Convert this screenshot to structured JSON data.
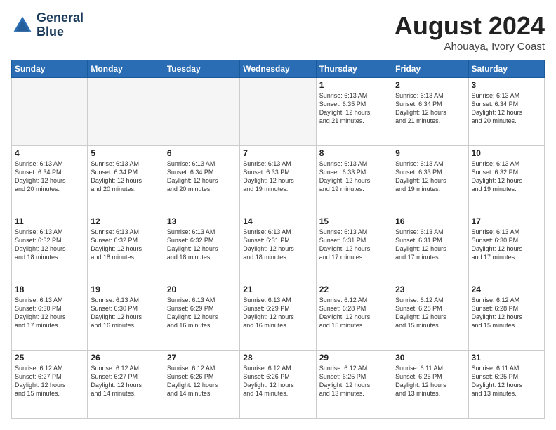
{
  "header": {
    "logo_line1": "General",
    "logo_line2": "Blue",
    "month_year": "August 2024",
    "location": "Ahouaya, Ivory Coast"
  },
  "days_of_week": [
    "Sunday",
    "Monday",
    "Tuesday",
    "Wednesday",
    "Thursday",
    "Friday",
    "Saturday"
  ],
  "weeks": [
    [
      {
        "date": "",
        "text": ""
      },
      {
        "date": "",
        "text": ""
      },
      {
        "date": "",
        "text": ""
      },
      {
        "date": "",
        "text": ""
      },
      {
        "date": "1",
        "text": "Sunrise: 6:13 AM\nSunset: 6:35 PM\nDaylight: 12 hours\nand 21 minutes."
      },
      {
        "date": "2",
        "text": "Sunrise: 6:13 AM\nSunset: 6:34 PM\nDaylight: 12 hours\nand 21 minutes."
      },
      {
        "date": "3",
        "text": "Sunrise: 6:13 AM\nSunset: 6:34 PM\nDaylight: 12 hours\nand 20 minutes."
      }
    ],
    [
      {
        "date": "4",
        "text": "Sunrise: 6:13 AM\nSunset: 6:34 PM\nDaylight: 12 hours\nand 20 minutes."
      },
      {
        "date": "5",
        "text": "Sunrise: 6:13 AM\nSunset: 6:34 PM\nDaylight: 12 hours\nand 20 minutes."
      },
      {
        "date": "6",
        "text": "Sunrise: 6:13 AM\nSunset: 6:34 PM\nDaylight: 12 hours\nand 20 minutes."
      },
      {
        "date": "7",
        "text": "Sunrise: 6:13 AM\nSunset: 6:33 PM\nDaylight: 12 hours\nand 19 minutes."
      },
      {
        "date": "8",
        "text": "Sunrise: 6:13 AM\nSunset: 6:33 PM\nDaylight: 12 hours\nand 19 minutes."
      },
      {
        "date": "9",
        "text": "Sunrise: 6:13 AM\nSunset: 6:33 PM\nDaylight: 12 hours\nand 19 minutes."
      },
      {
        "date": "10",
        "text": "Sunrise: 6:13 AM\nSunset: 6:32 PM\nDaylight: 12 hours\nand 19 minutes."
      }
    ],
    [
      {
        "date": "11",
        "text": "Sunrise: 6:13 AM\nSunset: 6:32 PM\nDaylight: 12 hours\nand 18 minutes."
      },
      {
        "date": "12",
        "text": "Sunrise: 6:13 AM\nSunset: 6:32 PM\nDaylight: 12 hours\nand 18 minutes."
      },
      {
        "date": "13",
        "text": "Sunrise: 6:13 AM\nSunset: 6:32 PM\nDaylight: 12 hours\nand 18 minutes."
      },
      {
        "date": "14",
        "text": "Sunrise: 6:13 AM\nSunset: 6:31 PM\nDaylight: 12 hours\nand 18 minutes."
      },
      {
        "date": "15",
        "text": "Sunrise: 6:13 AM\nSunset: 6:31 PM\nDaylight: 12 hours\nand 17 minutes."
      },
      {
        "date": "16",
        "text": "Sunrise: 6:13 AM\nSunset: 6:31 PM\nDaylight: 12 hours\nand 17 minutes."
      },
      {
        "date": "17",
        "text": "Sunrise: 6:13 AM\nSunset: 6:30 PM\nDaylight: 12 hours\nand 17 minutes."
      }
    ],
    [
      {
        "date": "18",
        "text": "Sunrise: 6:13 AM\nSunset: 6:30 PM\nDaylight: 12 hours\nand 17 minutes."
      },
      {
        "date": "19",
        "text": "Sunrise: 6:13 AM\nSunset: 6:30 PM\nDaylight: 12 hours\nand 16 minutes."
      },
      {
        "date": "20",
        "text": "Sunrise: 6:13 AM\nSunset: 6:29 PM\nDaylight: 12 hours\nand 16 minutes."
      },
      {
        "date": "21",
        "text": "Sunrise: 6:13 AM\nSunset: 6:29 PM\nDaylight: 12 hours\nand 16 minutes."
      },
      {
        "date": "22",
        "text": "Sunrise: 6:12 AM\nSunset: 6:28 PM\nDaylight: 12 hours\nand 15 minutes."
      },
      {
        "date": "23",
        "text": "Sunrise: 6:12 AM\nSunset: 6:28 PM\nDaylight: 12 hours\nand 15 minutes."
      },
      {
        "date": "24",
        "text": "Sunrise: 6:12 AM\nSunset: 6:28 PM\nDaylight: 12 hours\nand 15 minutes."
      }
    ],
    [
      {
        "date": "25",
        "text": "Sunrise: 6:12 AM\nSunset: 6:27 PM\nDaylight: 12 hours\nand 15 minutes."
      },
      {
        "date": "26",
        "text": "Sunrise: 6:12 AM\nSunset: 6:27 PM\nDaylight: 12 hours\nand 14 minutes."
      },
      {
        "date": "27",
        "text": "Sunrise: 6:12 AM\nSunset: 6:26 PM\nDaylight: 12 hours\nand 14 minutes."
      },
      {
        "date": "28",
        "text": "Sunrise: 6:12 AM\nSunset: 6:26 PM\nDaylight: 12 hours\nand 14 minutes."
      },
      {
        "date": "29",
        "text": "Sunrise: 6:12 AM\nSunset: 6:25 PM\nDaylight: 12 hours\nand 13 minutes."
      },
      {
        "date": "30",
        "text": "Sunrise: 6:11 AM\nSunset: 6:25 PM\nDaylight: 12 hours\nand 13 minutes."
      },
      {
        "date": "31",
        "text": "Sunrise: 6:11 AM\nSunset: 6:25 PM\nDaylight: 12 hours\nand 13 minutes."
      }
    ]
  ]
}
